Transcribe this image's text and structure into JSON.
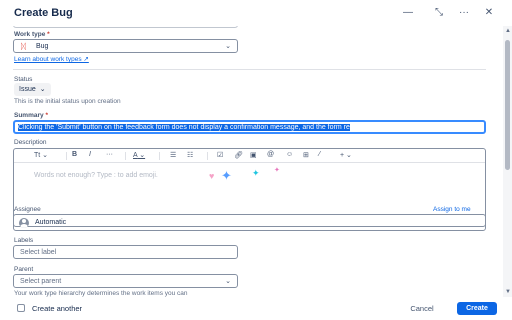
{
  "dialog": {
    "title": "Create Bug"
  },
  "header_icons": [
    "minimize-icon",
    "expand-icon",
    "more-icon",
    "close-icon"
  ],
  "form": {
    "work_type": {
      "label": "Work type",
      "required": "*",
      "value": "Bug",
      "link": "Learn about work types ↗"
    },
    "status": {
      "label": "Status",
      "value": "Issue",
      "helper": "This is the initial status upon creation"
    },
    "summary": {
      "label": "Summary",
      "required": "*",
      "value": "Clicking the 'Submit' button on the feedback form does not display a confirmation message, and the form re"
    },
    "description": {
      "label": "Description",
      "placeholder": "Words not enough? Type : to add emoji.",
      "toolbar": {
        "text_style": "Tt",
        "bold": "B",
        "italic": "I",
        "more": "···",
        "color": "A",
        "bullet_list": "☰",
        "numbered_list": "☷",
        "insert": "+"
      }
    },
    "assignee": {
      "label": "Assignee",
      "value": "Automatic",
      "assign_to_me": "Assign to me"
    },
    "labels": {
      "label": "Labels",
      "placeholder": "Select label"
    },
    "parent": {
      "label": "Parent",
      "placeholder": "Select parent",
      "helper": "Your work type hierarchy determines the work items you can"
    }
  },
  "footer": {
    "create_another": "Create another",
    "cancel": "Cancel",
    "create": "Create"
  },
  "colors": {
    "accent": "#0c66e4",
    "required": "#c9372c",
    "bug_icon": "#e2483d"
  }
}
